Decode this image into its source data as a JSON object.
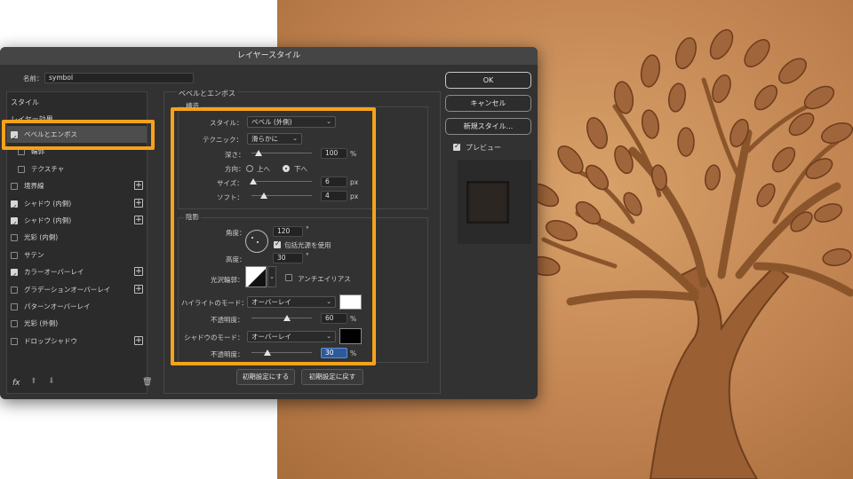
{
  "dialog": {
    "title": "レイヤースタイル",
    "name_label": "名前：",
    "name_value": "symbol"
  },
  "left_panel": {
    "style_header": "スタイル",
    "effects_header": "レイヤー効果",
    "items": [
      {
        "label": "ベベルとエンボス",
        "checked": true,
        "selected": true,
        "plus": false,
        "indent": false
      },
      {
        "label": "輪郭",
        "checked": false,
        "selected": false,
        "plus": false,
        "indent": true
      },
      {
        "label": "テクスチャ",
        "checked": false,
        "selected": false,
        "plus": false,
        "indent": true
      },
      {
        "label": "境界線",
        "checked": false,
        "selected": false,
        "plus": true,
        "indent": false
      },
      {
        "label": "シャドウ (内側)",
        "checked": true,
        "selected": false,
        "plus": true,
        "indent": false
      },
      {
        "label": "シャドウ (内側)",
        "checked": true,
        "selected": false,
        "plus": true,
        "indent": false
      },
      {
        "label": "光彩 (内側)",
        "checked": false,
        "selected": false,
        "plus": false,
        "indent": false
      },
      {
        "label": "サテン",
        "checked": false,
        "selected": false,
        "plus": false,
        "indent": false
      },
      {
        "label": "カラーオーバーレイ",
        "checked": true,
        "selected": false,
        "plus": true,
        "indent": false
      },
      {
        "label": "グラデーションオーバーレイ",
        "checked": false,
        "selected": false,
        "plus": true,
        "indent": false
      },
      {
        "label": "パターンオーバーレイ",
        "checked": false,
        "selected": false,
        "plus": false,
        "indent": false
      },
      {
        "label": "光彩 (外側)",
        "checked": false,
        "selected": false,
        "plus": false,
        "indent": false
      },
      {
        "label": "ドロップシャドウ",
        "checked": false,
        "selected": false,
        "plus": true,
        "indent": false
      }
    ],
    "footer_fx": "fx"
  },
  "bevel": {
    "section_title": "ベベルとエンボス",
    "structure_title": "構造",
    "style_label": "スタイル：",
    "style_value": "ベベル (外側)",
    "technique_label": "テクニック：",
    "technique_value": "滑らかに",
    "depth_label": "深さ：",
    "depth_value": "100",
    "depth_unit": "%",
    "direction_label": "方向：",
    "direction_up": "上へ",
    "direction_down": "下へ",
    "direction_selected": "下へ",
    "size_label": "サイズ：",
    "size_value": "6",
    "size_unit": "px",
    "soften_label": "ソフト：",
    "soften_value": "4",
    "soften_unit": "px",
    "shading_title": "陰影",
    "angle_label": "角度：",
    "angle_value": "120",
    "angle_unit": "°",
    "global_light_label": "包括光源を使用",
    "global_light_checked": true,
    "altitude_label": "高度：",
    "altitude_value": "30",
    "altitude_unit": "°",
    "gloss_label": "光沢輪郭：",
    "antialias_label": "アンチエイリアス",
    "antialias_checked": false,
    "highlight_mode_label": "ハイライトのモード：",
    "highlight_mode_value": "オーバーレイ",
    "highlight_color": "#ffffff",
    "highlight_opacity_label": "不透明度：",
    "highlight_opacity_value": "60",
    "shadow_mode_label": "シャドウのモード：",
    "shadow_mode_value": "オーバーレイ",
    "shadow_color": "#000000",
    "shadow_opacity_label": "不透明度：",
    "shadow_opacity_value": "30",
    "percent": "%",
    "reset_default_button": "初期設定にする",
    "restore_default_button": "初期設定に戻す"
  },
  "right_panel": {
    "ok_button": "OK",
    "cancel_button": "キャンセル",
    "new_style_button": "新規スタイル...",
    "preview_label": "プレビュー",
    "preview_checked": true
  },
  "colors": {
    "highlight_orange": "#f7a21b",
    "dialog_bg": "#323232",
    "leather": "#c58850"
  }
}
